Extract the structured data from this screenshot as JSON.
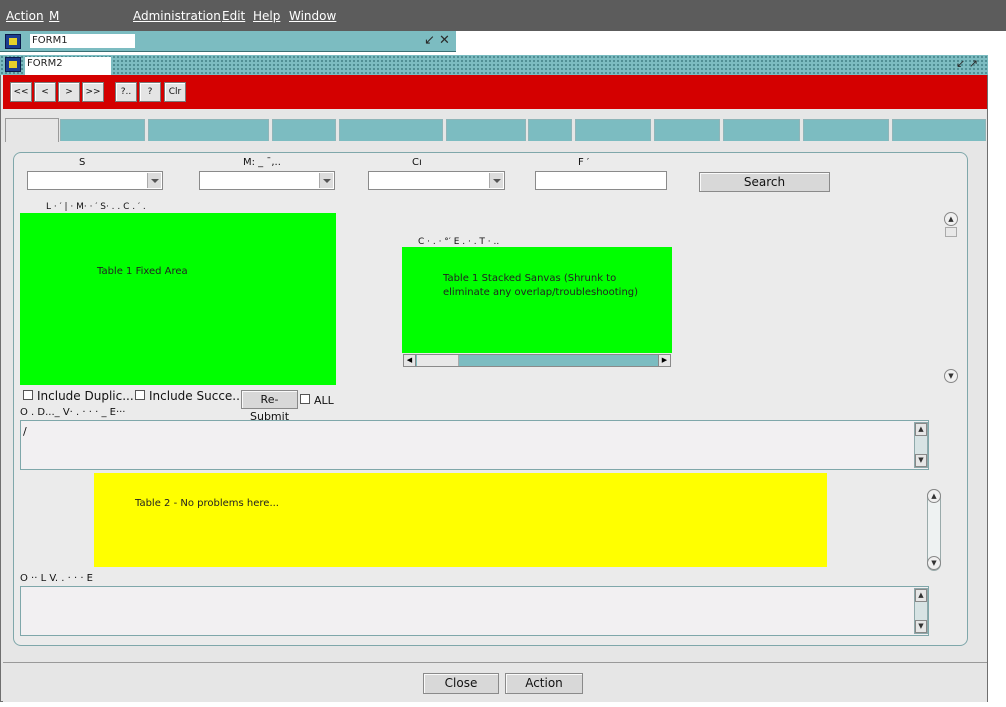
{
  "menubar": {
    "items": [
      "Action",
      "M",
      "Administration",
      "Edit",
      "Help",
      "Window"
    ]
  },
  "form1": {
    "title": "FORM1",
    "controls": "↙ ✕"
  },
  "form2": {
    "title": "FORM2",
    "controls": "↙ ↗"
  },
  "toolbar": {
    "buttons": [
      "<<",
      "<",
      ">",
      ">>",
      "?..",
      "?",
      "Clr"
    ]
  },
  "filters": {
    "labels": [
      "S",
      "M: _ ¯,..",
      "Cı",
      "F  ′"
    ],
    "search_label": "Search"
  },
  "table1": {
    "header_partial": "L  ·  ′   |  ·    M·   ·  ′     S· . .    C  . ′  .",
    "fixed_area_label": "Table 1 Fixed Area",
    "stacked_header_partial": "C  ·  .  ·  °′     E  .  · .      T  · ..",
    "stacked_label": "Table 1 Stacked Sanvas (Shrunk to eliminate any overlap/troubleshooting)"
  },
  "checkboxes": {
    "include_duplicates": "Include Duplic...",
    "include_successes": "Include Succe...",
    "resubmit_label": "Re-Submit",
    "all_label": "ALL"
  },
  "errors1": {
    "label": "O  . D..._ V· . · · · _ E···",
    "text": "/"
  },
  "table2": {
    "label": "Table 2 - No problems here..."
  },
  "errors2": {
    "label": "O  ··  L    V. . · · · E"
  },
  "footer": {
    "close_label": "Close",
    "action_label": "Action"
  },
  "colors": {
    "menubar": "#5c5c5c",
    "toolbar": "#d40000",
    "tab": "#7cbcc1",
    "green_area": "#00ff00",
    "yellow_area": "#ffff00"
  }
}
